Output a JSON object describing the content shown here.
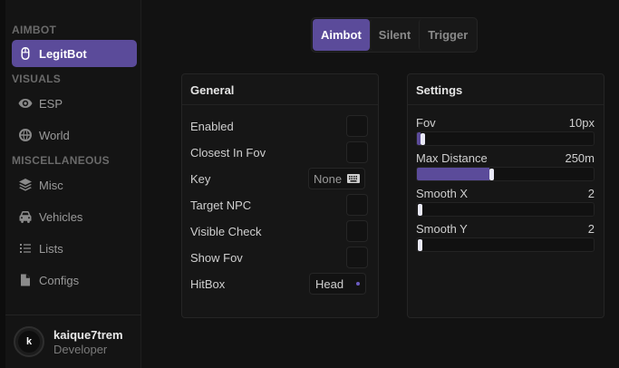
{
  "sidebar": {
    "sections": [
      {
        "title": "AIMBOT"
      },
      {
        "title": "VISUALS"
      },
      {
        "title": "MISCELLANEOUS"
      }
    ],
    "items": [
      {
        "label": "LegitBot",
        "icon": "mouse-icon",
        "active": true
      },
      {
        "label": "ESP",
        "icon": "eye-icon"
      },
      {
        "label": "World",
        "icon": "globe-icon"
      },
      {
        "label": "Misc",
        "icon": "layers-icon"
      },
      {
        "label": "Vehicles",
        "icon": "car-icon"
      },
      {
        "label": "Lists",
        "icon": "list-icon"
      },
      {
        "label": "Configs",
        "icon": "file-icon"
      }
    ],
    "user": {
      "initial": "k",
      "name": "kaique7trem",
      "role": "Developer"
    }
  },
  "tabs": [
    {
      "label": "Aimbot",
      "active": true
    },
    {
      "label": "Silent"
    },
    {
      "label": "Trigger"
    }
  ],
  "general": {
    "title": "General",
    "rows": [
      {
        "label": "Enabled",
        "type": "checkbox",
        "checked": false
      },
      {
        "label": "Closest In Fov",
        "type": "checkbox",
        "checked": false
      },
      {
        "label": "Key",
        "type": "key",
        "value": "None"
      },
      {
        "label": "Target NPC",
        "type": "checkbox",
        "checked": false
      },
      {
        "label": "Visible Check",
        "type": "checkbox",
        "checked": false
      },
      {
        "label": "Show Fov",
        "type": "checkbox",
        "checked": false
      },
      {
        "label": "HitBox",
        "type": "select",
        "value": "Head"
      }
    ]
  },
  "settings": {
    "title": "Settings",
    "sliders": [
      {
        "label": "Fov",
        "value": "10px",
        "fraction": 0.02
      },
      {
        "label": "Max Distance",
        "value": "250m",
        "fraction": 0.41
      },
      {
        "label": "Smooth X",
        "value": "2",
        "fraction": 0.0
      },
      {
        "label": "Smooth Y",
        "value": "2",
        "fraction": 0.0
      }
    ]
  },
  "colors": {
    "accent": "#5b4b9a",
    "background": "#121212",
    "panel": "#161616"
  }
}
